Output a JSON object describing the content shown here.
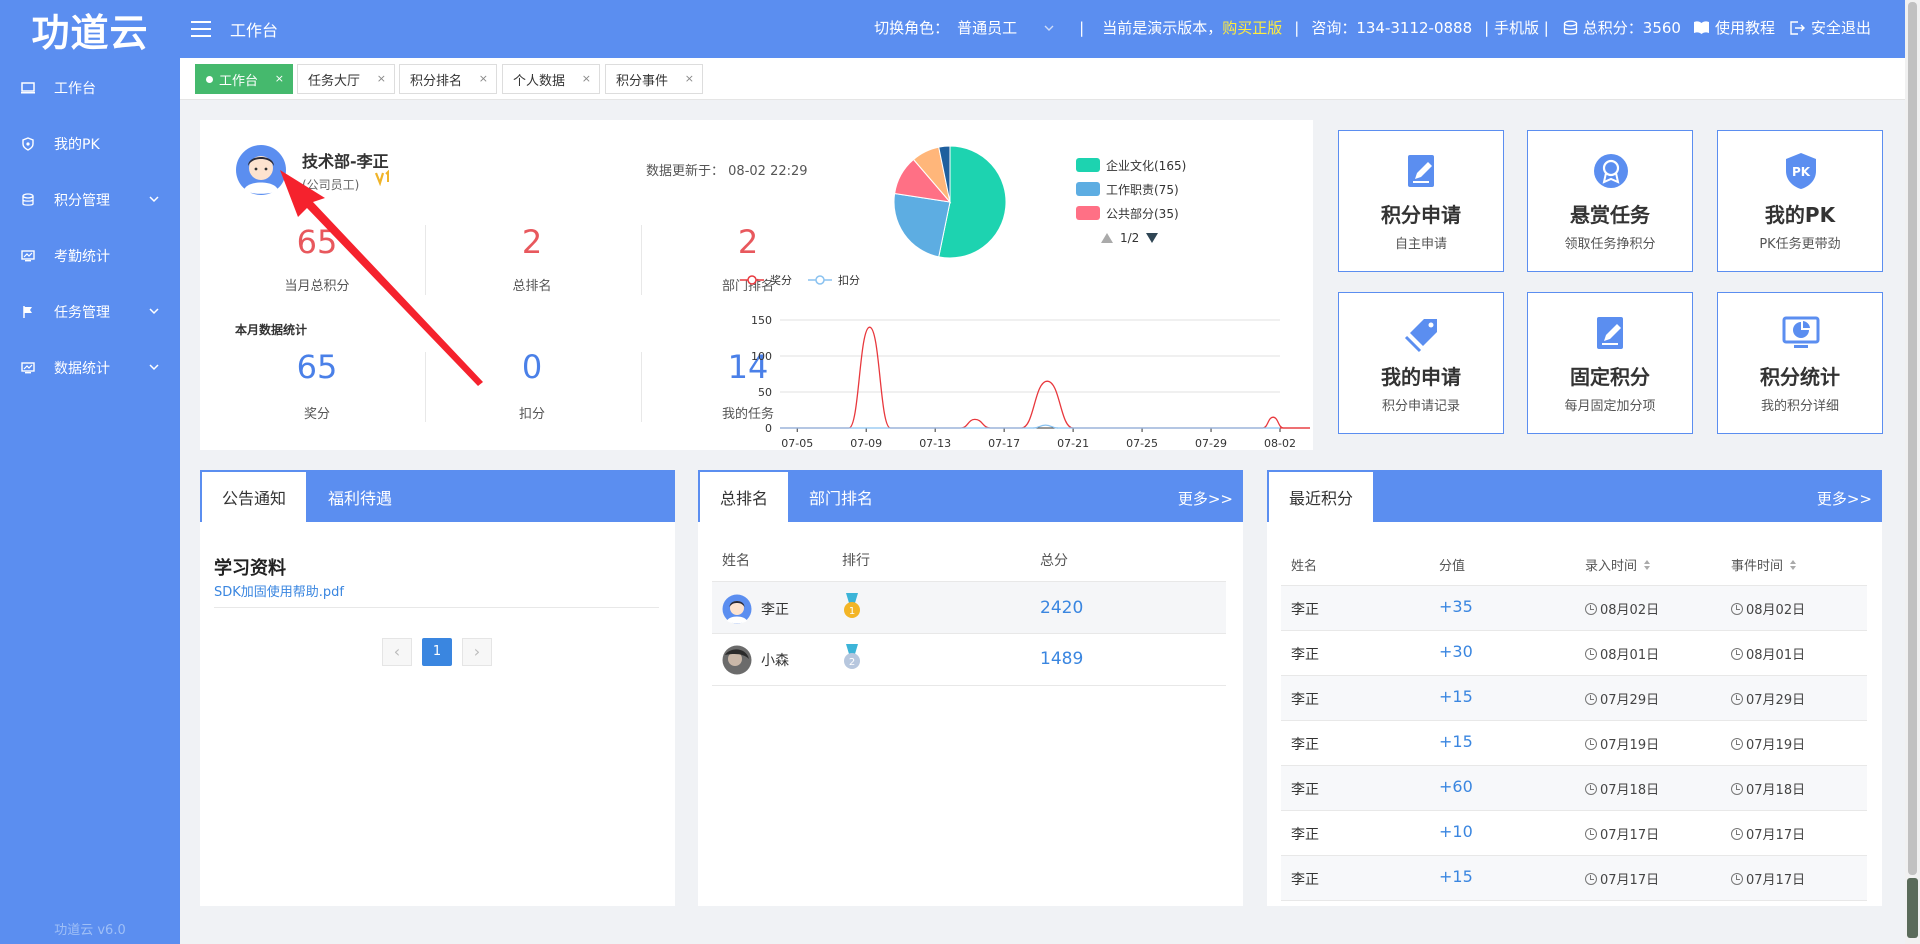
{
  "brand": {
    "logo": "功道云",
    "version": "功道云 v6.0"
  },
  "sidebar": {
    "items": [
      {
        "label": "工作台",
        "icon": "monitor-icon",
        "expandable": false
      },
      {
        "label": "我的PK",
        "icon": "shield-icon",
        "expandable": false
      },
      {
        "label": "积分管理",
        "icon": "database-icon",
        "expandable": true
      },
      {
        "label": "考勤统计",
        "icon": "chart-monitor-icon",
        "expandable": false
      },
      {
        "label": "任务管理",
        "icon": "flag-icon",
        "expandable": true
      },
      {
        "label": "数据统计",
        "icon": "chart-monitor-icon",
        "expandable": true
      }
    ]
  },
  "topbar": {
    "title": "工作台",
    "role_label": "切换角色：",
    "role_value": "普通员工",
    "sep": "|",
    "demo_text": "当前是演示版本，",
    "buy_text": "购买正版",
    "consult": "咨询：134-3112-0888",
    "mobile": "| 手机版 |",
    "points": "总积分：3560",
    "tutorial": "使用教程",
    "logout": "安全退出"
  },
  "tabs": [
    {
      "label": "工作台",
      "active": true
    },
    {
      "label": "任务大厅",
      "active": false
    },
    {
      "label": "积分排名",
      "active": false
    },
    {
      "label": "个人数据",
      "active": false
    },
    {
      "label": "积分事件",
      "active": false
    }
  ],
  "profile": {
    "name": "技术部-李正",
    "role": "(公司员工)",
    "updated_label": "数据更新于：",
    "updated_value": "08-02 22:29",
    "month_title": "本月数据统计",
    "stats_top": [
      {
        "value": "65",
        "label": "当月总积分"
      },
      {
        "value": "2",
        "label": "总排名"
      },
      {
        "value": "2",
        "label": "部门排名"
      }
    ],
    "stats_bottom": [
      {
        "value": "65",
        "label": "奖分"
      },
      {
        "value": "0",
        "label": "扣分"
      },
      {
        "value": "14",
        "label": "我的任务"
      }
    ]
  },
  "chart_data": [
    {
      "type": "pie",
      "legend": [
        "企业文化(165)",
        "工作职责(75)",
        "公共部分(35)"
      ],
      "legend_page": "1/2",
      "slices": [
        {
          "name": "企业文化",
          "value": 165,
          "color": "#1dd3b0"
        },
        {
          "name": "工作职责",
          "value": 75,
          "color": "#5dade2"
        },
        {
          "name": "公共部分",
          "value": 35,
          "color": "#ff7085"
        },
        {
          "value": 25,
          "color": "#ffb67a"
        },
        {
          "value": 10,
          "color": "#1f5f9e"
        }
      ]
    },
    {
      "type": "line",
      "legend": [
        {
          "name": "奖分",
          "color": "#e8383d"
        },
        {
          "name": "扣分",
          "color": "#8ac2f0"
        }
      ],
      "ylim": [
        0,
        150
      ],
      "yticks": [
        0,
        50,
        100,
        150
      ],
      "xticks": [
        "07-05",
        "07-09",
        "07-13",
        "07-17",
        "07-21",
        "07-25",
        "07-29",
        "08-02"
      ],
      "x_days": 29,
      "series": [
        {
          "name": "奖分",
          "points": [
            [
              4,
              0
            ],
            [
              5.2,
              140
            ],
            [
              6.4,
              0
            ],
            [
              10.5,
              0
            ],
            [
              11.3,
              12
            ],
            [
              12.2,
              0
            ],
            [
              14,
              0
            ],
            [
              15.5,
              65
            ],
            [
              17,
              0
            ],
            [
              28,
              0
            ],
            [
              28.6,
              15
            ],
            [
              29.2,
              0
            ],
            [
              31,
              0
            ],
            [
              32.4,
              38
            ],
            [
              33.6,
              0
            ]
          ]
        },
        {
          "name": "扣分",
          "points": [
            [
              14.7,
              0
            ],
            [
              15.4,
              4
            ],
            [
              16.1,
              0
            ]
          ]
        }
      ]
    }
  ],
  "quick_links": [
    {
      "title": "积分申请",
      "sub": "自主申请",
      "icon": "edit-icon"
    },
    {
      "title": "悬赏任务",
      "sub": "领取任务挣积分",
      "icon": "award-icon"
    },
    {
      "title": "我的PK",
      "sub": "PK任务更带劲",
      "icon": "pk-shield-icon"
    },
    {
      "title": "我的申请",
      "sub": "积分申请记录",
      "icon": "tag-icon"
    },
    {
      "title": "固定积分",
      "sub": "每月固定加分项",
      "icon": "edit-icon"
    },
    {
      "title": "积分统计",
      "sub": "我的积分详细",
      "icon": "pie-screen-icon"
    }
  ],
  "notice": {
    "tabs": [
      "公告通知",
      "福利待遇"
    ],
    "item_title": "学习资料",
    "item_link": "SDK加固使用帮助.pdf",
    "page": "1",
    "prev": "‹",
    "next": "›"
  },
  "ranking": {
    "tabs": [
      "总排名",
      "部门排名"
    ],
    "more": "更多>>",
    "headers": [
      "姓名",
      "排行",
      "总分"
    ],
    "rows": [
      {
        "name": "李正",
        "medal": "gold",
        "rank": "1",
        "score": "2420"
      },
      {
        "name": "小森",
        "medal": "silver",
        "rank": "2",
        "score": "1489"
      }
    ]
  },
  "recent": {
    "tab": "最近积分",
    "more": "更多>>",
    "headers": [
      "姓名",
      "分值",
      "录入时间",
      "事件时间"
    ],
    "rows": [
      {
        "name": "李正",
        "score": "+35",
        "entry": "08月02日",
        "event": "08月02日"
      },
      {
        "name": "李正",
        "score": "+30",
        "entry": "08月01日",
        "event": "08月01日"
      },
      {
        "name": "李正",
        "score": "+15",
        "entry": "07月29日",
        "event": "07月29日"
      },
      {
        "name": "李正",
        "score": "+15",
        "entry": "07月19日",
        "event": "07月19日"
      },
      {
        "name": "李正",
        "score": "+60",
        "entry": "07月18日",
        "event": "07月18日"
      },
      {
        "name": "李正",
        "score": "+10",
        "entry": "07月17日",
        "event": "07月17日"
      },
      {
        "name": "李正",
        "score": "+15",
        "entry": "07月17日",
        "event": "07月17日"
      }
    ]
  },
  "colors": {
    "primary": "#5b8ef0",
    "active_tab": "#45b96d",
    "red": "#e8585d",
    "blue": "#4a80e8",
    "link": "#3a86e0"
  }
}
